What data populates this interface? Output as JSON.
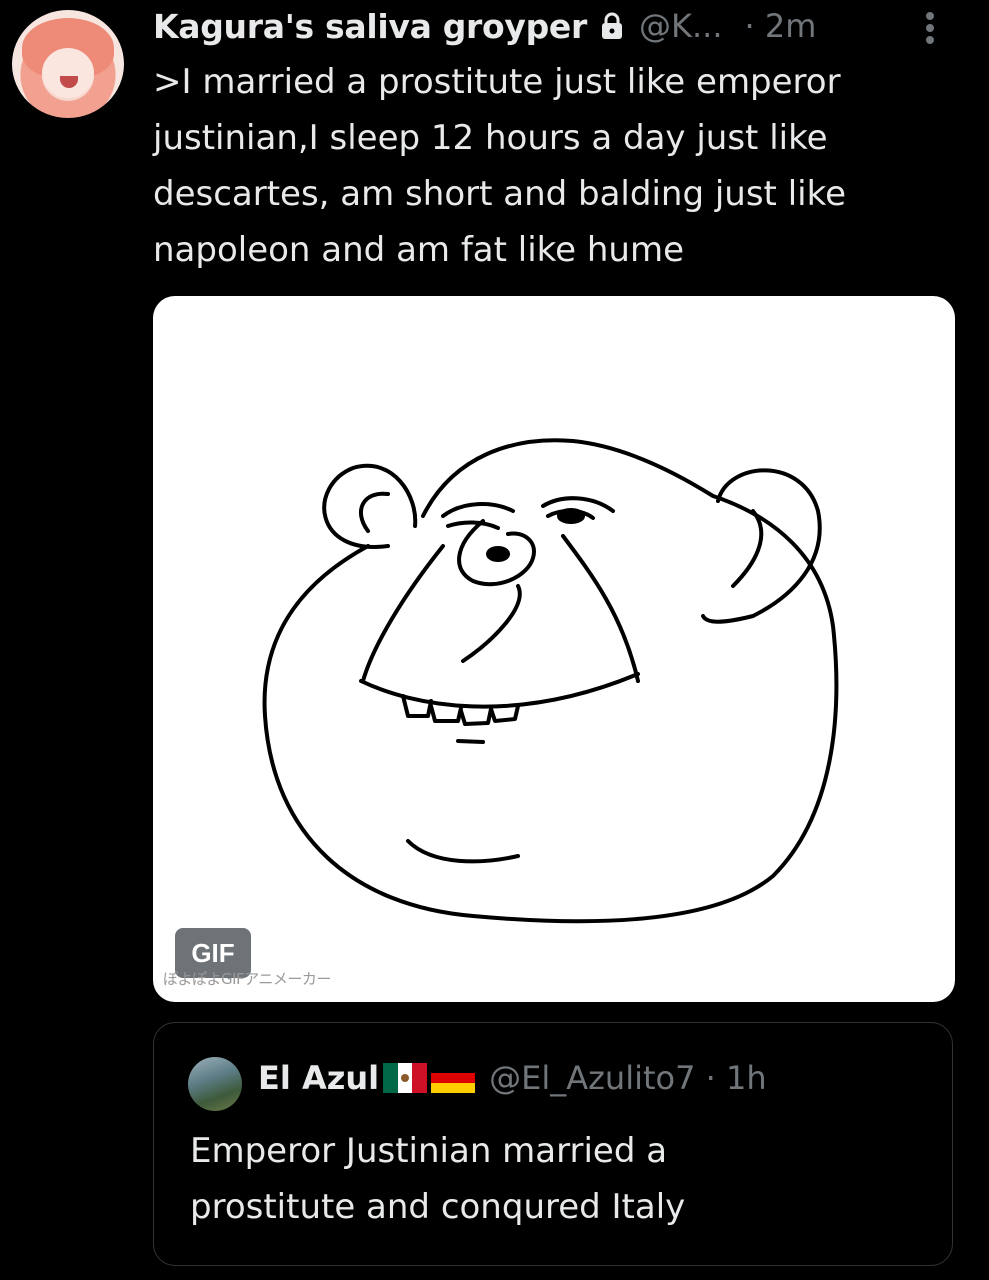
{
  "tweet": {
    "author_name": "Kagura's saliva groyper",
    "handle": "@K...",
    "time": "· 2m",
    "text": ">I married a prostitute just like emperor\njustinian,I sleep 12 hours a day just like\ndescartes, am short and balding just like\nnapoleon and am fat like hume",
    "media": {
      "badge": "GIF",
      "watermark": "ぽよぽよGIFアニメーカー"
    }
  },
  "quote": {
    "author_name": "El Azul",
    "flags": [
      "mexico-flag",
      "germany-flag"
    ],
    "handle": "@El_Azulito7 · 1h",
    "text": "Emperor Justinian married a\nprostitute and conqured Italy"
  },
  "colors": {
    "background": "#000000",
    "text": "#e7e9ea",
    "muted": "#71767b",
    "border": "#2f3336"
  }
}
